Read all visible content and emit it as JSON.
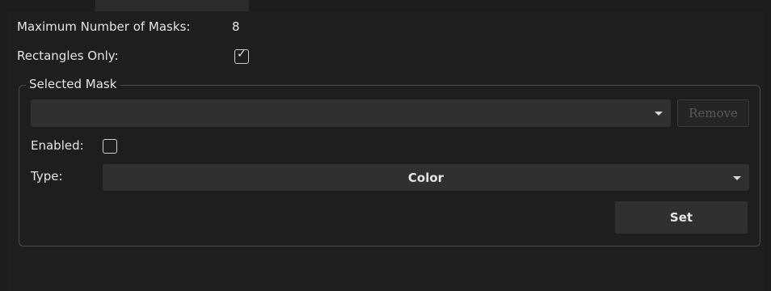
{
  "settings": {
    "max_masks_label": "Maximum Number of Masks:",
    "max_masks_value": "8",
    "rectangles_only_label": "Rectangles Only:",
    "rectangles_only_checked": true
  },
  "selected_mask": {
    "group_title": "Selected Mask",
    "mask_select_value": "",
    "remove_label": "Remove",
    "enabled_label": "Enabled:",
    "enabled_checked": false,
    "type_label": "Type:",
    "type_value": "Color",
    "set_label": "Set"
  }
}
